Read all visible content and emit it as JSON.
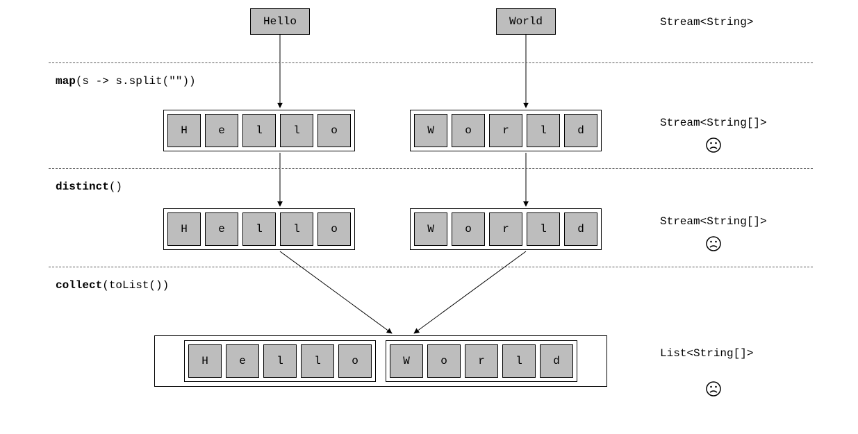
{
  "input": {
    "left": "Hello",
    "right": "World"
  },
  "stages": [
    {
      "op_bold": "map",
      "op_rest": "(s -> s.split(\"\"))",
      "type": "Stream<String[]>",
      "frown": true,
      "left": [
        "H",
        "e",
        "l",
        "l",
        "o"
      ],
      "right": [
        "W",
        "o",
        "r",
        "l",
        "d"
      ]
    },
    {
      "op_bold": "distinct",
      "op_rest": "()",
      "type": "Stream<String[]>",
      "frown": true,
      "left": [
        "H",
        "e",
        "l",
        "l",
        "o"
      ],
      "right": [
        "W",
        "o",
        "r",
        "l",
        "d"
      ]
    },
    {
      "op_bold": "collect",
      "op_rest": "(toList())",
      "type": "List<String[]>",
      "frown": true,
      "left": [
        "H",
        "e",
        "l",
        "l",
        "o"
      ],
      "right": [
        "W",
        "o",
        "r",
        "l",
        "d"
      ]
    }
  ],
  "header_type": "Stream<String>"
}
